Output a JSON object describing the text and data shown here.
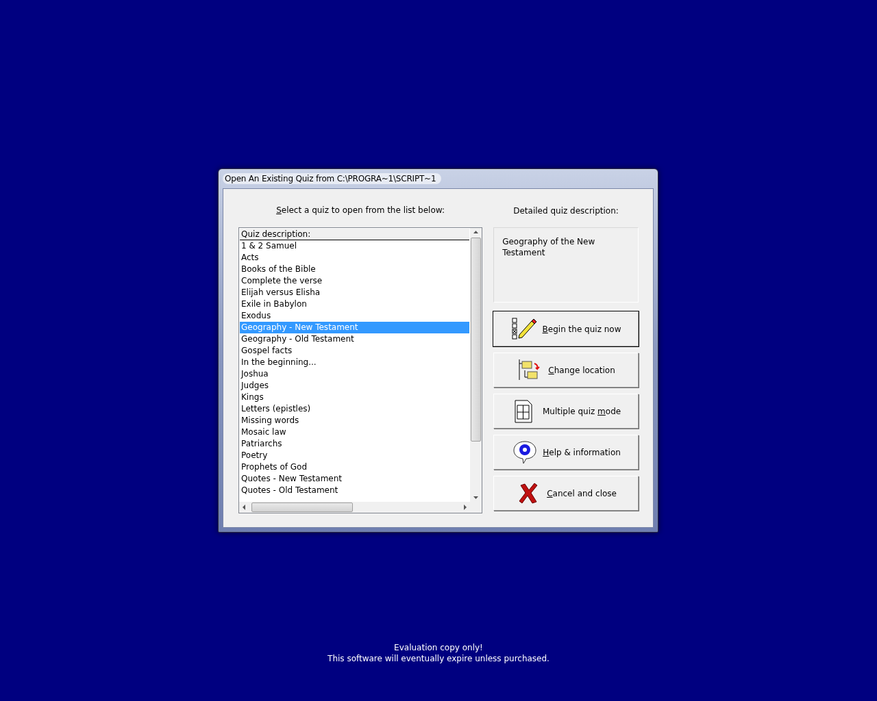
{
  "window": {
    "title": "Open An Existing Quiz from C:\\PROGRA~1\\SCRIPT~1"
  },
  "list_label": {
    "key": "S",
    "after": "elect a quiz to open from the list below:"
  },
  "quiz_list": {
    "header": "Quiz description:",
    "items": [
      {
        "label": "1 & 2 Samuel",
        "selected": false
      },
      {
        "label": "Acts",
        "selected": false
      },
      {
        "label": "Books of the Bible",
        "selected": false
      },
      {
        "label": "Complete the verse",
        "selected": false
      },
      {
        "label": "Elijah versus Elisha",
        "selected": false
      },
      {
        "label": "Exile in Babylon",
        "selected": false
      },
      {
        "label": "Exodus",
        "selected": false
      },
      {
        "label": "Geography - New Testament",
        "selected": true
      },
      {
        "label": "Geography - Old Testament",
        "selected": false
      },
      {
        "label": "Gospel facts",
        "selected": false
      },
      {
        "label": "In the beginning...",
        "selected": false
      },
      {
        "label": "Joshua",
        "selected": false
      },
      {
        "label": "Judges",
        "selected": false
      },
      {
        "label": "Kings",
        "selected": false
      },
      {
        "label": "Letters (epistles)",
        "selected": false
      },
      {
        "label": "Missing words",
        "selected": false
      },
      {
        "label": "Mosaic law",
        "selected": false
      },
      {
        "label": "Patriarchs",
        "selected": false
      },
      {
        "label": "Poetry",
        "selected": false
      },
      {
        "label": "Prophets of God",
        "selected": false
      },
      {
        "label": "Quotes - New Testament",
        "selected": false
      },
      {
        "label": "Quotes - Old Testament",
        "selected": false
      }
    ]
  },
  "description": {
    "label": "Detailed quiz description:",
    "text": "Geography of the New Testament"
  },
  "buttons": [
    {
      "kind": "begin",
      "key": "B",
      "after": "egin the quiz now",
      "default": true
    },
    {
      "kind": "location",
      "key": "C",
      "after": "hange location",
      "default": false
    },
    {
      "kind": "multiple",
      "before": "Multiple quiz ",
      "key": "m",
      "after": "ode",
      "default": false
    },
    {
      "kind": "help",
      "key": "H",
      "after": "elp & information",
      "default": false
    },
    {
      "kind": "cancel",
      "key": "C",
      "after": "ancel and close",
      "default": false
    }
  ],
  "footer": [
    "Evaluation copy only!",
    "This software will eventually expire unless purchased."
  ]
}
